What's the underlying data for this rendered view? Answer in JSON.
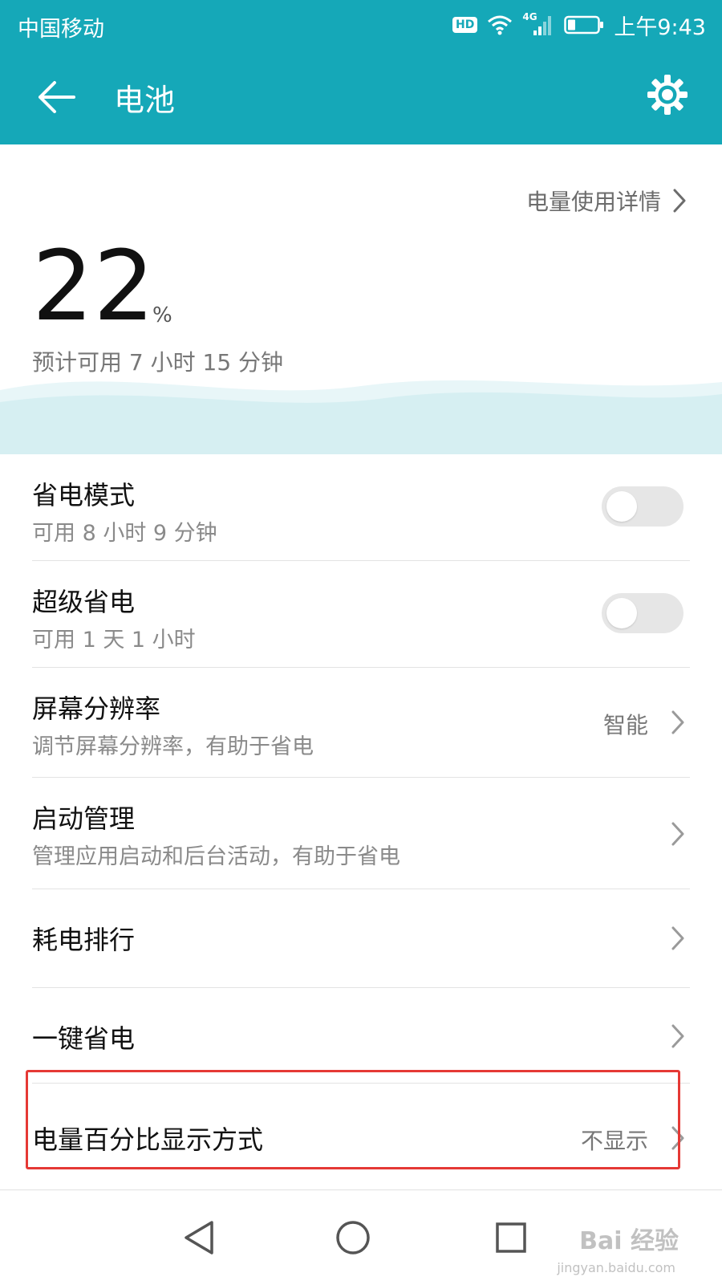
{
  "status": {
    "carrier": "中国移动",
    "hd": "HD",
    "network": "4G",
    "time": "上午9:43"
  },
  "appbar": {
    "title": "电池"
  },
  "hero": {
    "detail_link": "电量使用详情",
    "percent": "22",
    "percent_sign": "%",
    "estimate": "预计可用 7 小时 15 分钟",
    "battery_level_fraction": 0.22
  },
  "rows": {
    "power_saving": {
      "title": "省电模式",
      "subtitle": "可用 8 小时 9 分钟",
      "enabled": false
    },
    "ultra_saving": {
      "title": "超级省电",
      "subtitle": "可用 1 天 1 小时",
      "enabled": false
    },
    "resolution": {
      "title": "屏幕分辨率",
      "subtitle": "调节屏幕分辨率，有助于省电",
      "value": "智能"
    },
    "startup": {
      "title": "启动管理",
      "subtitle": "管理应用启动和后台活动，有助于省电"
    },
    "ranking": {
      "title": "耗电排行"
    },
    "one_key": {
      "title": "一键省电"
    },
    "percent_display": {
      "title": "电量百分比显示方式",
      "value": "不显示"
    }
  },
  "watermark": {
    "text": "Bai 经验",
    "sub": "jingyan.baidu.com"
  },
  "colors": {
    "primary": "#15a8b8",
    "highlight": "#e53935",
    "wave": "#d6eff2"
  }
}
